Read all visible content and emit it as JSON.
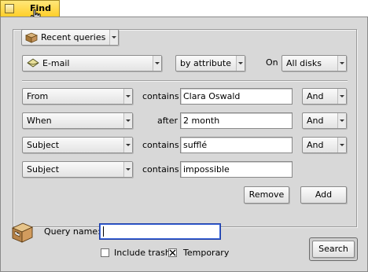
{
  "window": {
    "title": "Find"
  },
  "recent": {
    "label": "Recent queries",
    "icon": "box-icon"
  },
  "type_menu": {
    "label": "E-mail",
    "icon": "mail-icon"
  },
  "mode_menu": {
    "label": "by attribute"
  },
  "on": {
    "label": "On",
    "value": "All disks"
  },
  "rows": [
    {
      "attribute": "From",
      "op": "contains",
      "value": "Clara Oswald",
      "conj": "And"
    },
    {
      "attribute": "When",
      "op": "after",
      "value": "2 month",
      "conj": "And"
    },
    {
      "attribute": "Subject",
      "op": "contains",
      "value": "sufflé",
      "conj": "And"
    },
    {
      "attribute": "Subject",
      "op": "contains",
      "value": "impossible"
    }
  ],
  "buttons": {
    "remove": "Remove",
    "add": "Add",
    "search": "Search"
  },
  "query_name": {
    "label": "Query name:",
    "value": ""
  },
  "options": {
    "include_trash": {
      "label": "Include trash",
      "checked": false
    },
    "temporary": {
      "label": "Temporary",
      "checked": true
    }
  }
}
